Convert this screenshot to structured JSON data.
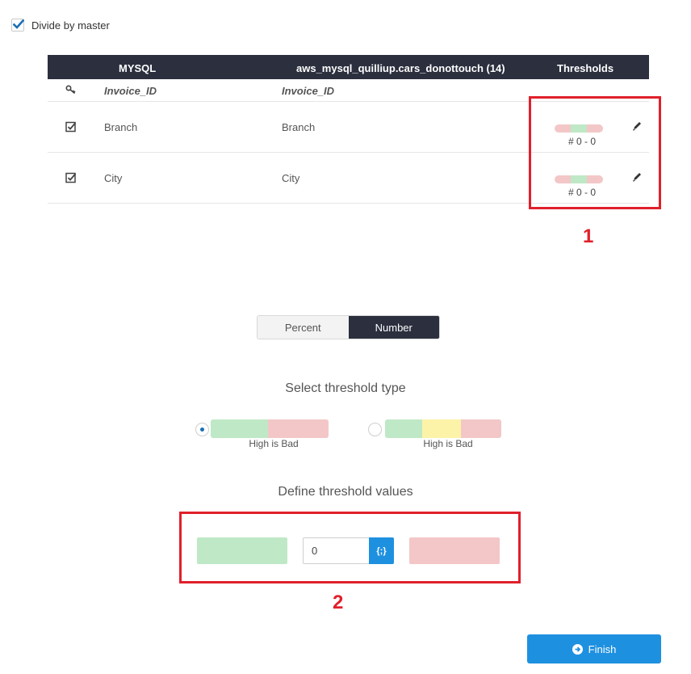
{
  "options": {
    "divide_by_master": {
      "label": "Divide by master",
      "checked": true
    }
  },
  "table": {
    "headers": {
      "source": "MYSQL",
      "target": "aws_mysql_quilliup.cars_donottouch (14)",
      "thresholds": "Thresholds"
    },
    "key_row": {
      "source": "Invoice_ID",
      "target": "Invoice_ID"
    },
    "rows": [
      {
        "source": "Branch",
        "target": "Branch",
        "checked": true,
        "threshold": "# 0 - 0"
      },
      {
        "source": "City",
        "target": "City",
        "checked": true,
        "threshold": "# 0 - 0"
      }
    ]
  },
  "annotations": {
    "first": "1",
    "second": "2"
  },
  "mode_toggle": {
    "options": [
      "Percent",
      "Number"
    ],
    "selected": "Number"
  },
  "threshold_type": {
    "title": "Select threshold type",
    "options": [
      {
        "label": "High is Bad",
        "selected": true
      },
      {
        "label": "High is Bad",
        "selected": false
      }
    ]
  },
  "threshold_values": {
    "title": "Define threshold values",
    "value": "0",
    "variable_button": "{;}"
  },
  "actions": {
    "finish": "Finish"
  },
  "colors": {
    "header_bg": "#2b2f3e",
    "accent": "#1e90e0",
    "good": "#bfe8c6",
    "warn": "#fdf3a8",
    "bad": "#f3c7c7",
    "annotation": "#e0202b"
  }
}
